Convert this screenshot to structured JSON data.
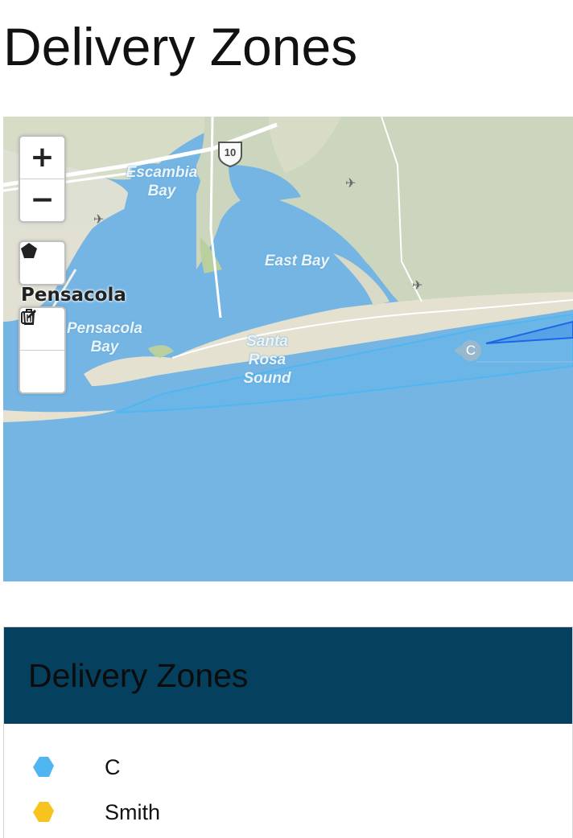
{
  "page": {
    "title": "Delivery Zones"
  },
  "map": {
    "water_labels": {
      "escambia_bay": "Escambia Bay",
      "east_bay": "East Bay",
      "pensacola_bay": "Pensacola Bay",
      "santa_rosa_sound": "Santa Rosa Sound"
    },
    "city_label": "Pensacola",
    "highway_shield": "10",
    "zone_marker_label": "C",
    "controls": {
      "zoom_in": "+",
      "zoom_out": "−",
      "draw_polygon_icon": "pentagon-icon",
      "edit_icon": "edit-icon",
      "delete_icon": "trash-icon"
    },
    "colors": {
      "water": "#75b5e3",
      "land": "#dde0cb",
      "zone_outline": "#4fb6f2",
      "zone_active": "#1b66e6"
    }
  },
  "panel": {
    "title": "Delivery Zones",
    "header_color": "#05405e",
    "zones": [
      {
        "name": "C",
        "color": "#4fb6f2"
      },
      {
        "name": "Smith",
        "color": "#f7c41f"
      }
    ]
  }
}
